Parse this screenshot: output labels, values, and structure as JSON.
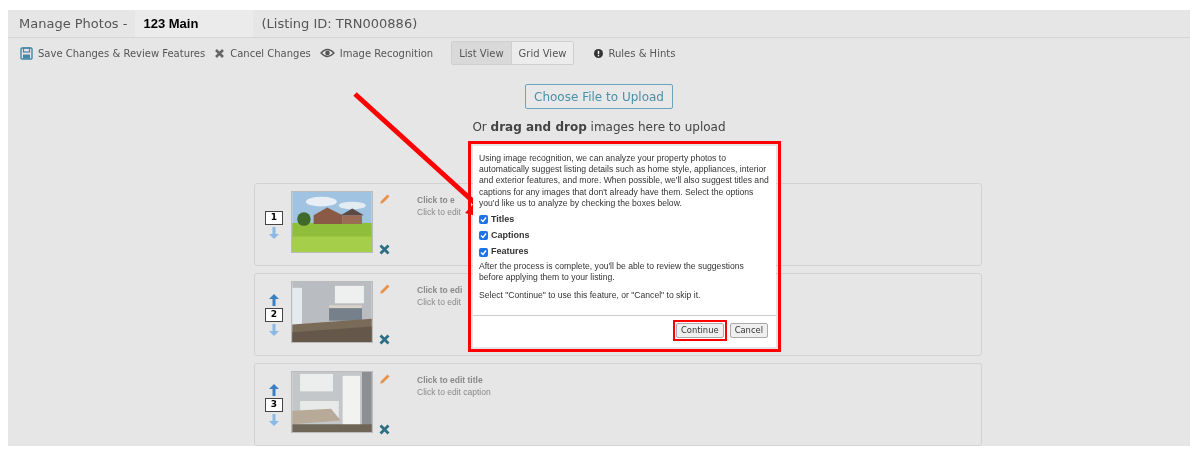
{
  "header": {
    "title": "Manage Photos -",
    "address": "123 Main",
    "listing_id": "(Listing ID: TRN000886)"
  },
  "toolbar": {
    "items": [
      {
        "kind": "save",
        "label": "Save Changes & Review Features"
      },
      {
        "kind": "cancel",
        "label": "Cancel Changes"
      },
      {
        "kind": "eye",
        "label": "Image Recognition"
      }
    ],
    "views": [
      {
        "label": "List View",
        "selected": true
      },
      {
        "label": "Grid View",
        "selected": false
      }
    ],
    "hints": "Rules & Hints"
  },
  "upload": {
    "button": "Choose File to Upload",
    "hint": "Or **drag and drop** images here to upload"
  },
  "photos": [
    {
      "order": "1",
      "can_move_up": false,
      "title": "Click to e",
      "caption": "Click to edit"
    },
    {
      "order": "2",
      "can_move_up": true,
      "title": "Click to edi",
      "caption": "Click to edit"
    },
    {
      "order": "3",
      "can_move_up": true,
      "title": "Click to edit title",
      "caption": "Click to edit caption"
    }
  ],
  "dialog": {
    "intro": "Using image recognition, we can analyze your property photos to automatically suggest listing details such as home style, appliances, interior and exterior features, and more. When possible, we'll also suggest titles and captions for any images that don't already have them. Select the options you'd like us to analyze by checking the boxes below.",
    "options": [
      {
        "label": "Titles",
        "checked": true
      },
      {
        "label": "Captions",
        "checked": true
      },
      {
        "label": "Features",
        "checked": true
      }
    ],
    "after": "After the process is complete, you'll be able to review the suggestions before applying them to your listing.",
    "instruction": "Select \"Continue\" to use this feature, or \"Cancel\" to skip it.",
    "buttons": [
      {
        "label": "Continue",
        "highlighted": true
      },
      {
        "label": "Cancel",
        "highlighted": false
      }
    ]
  }
}
